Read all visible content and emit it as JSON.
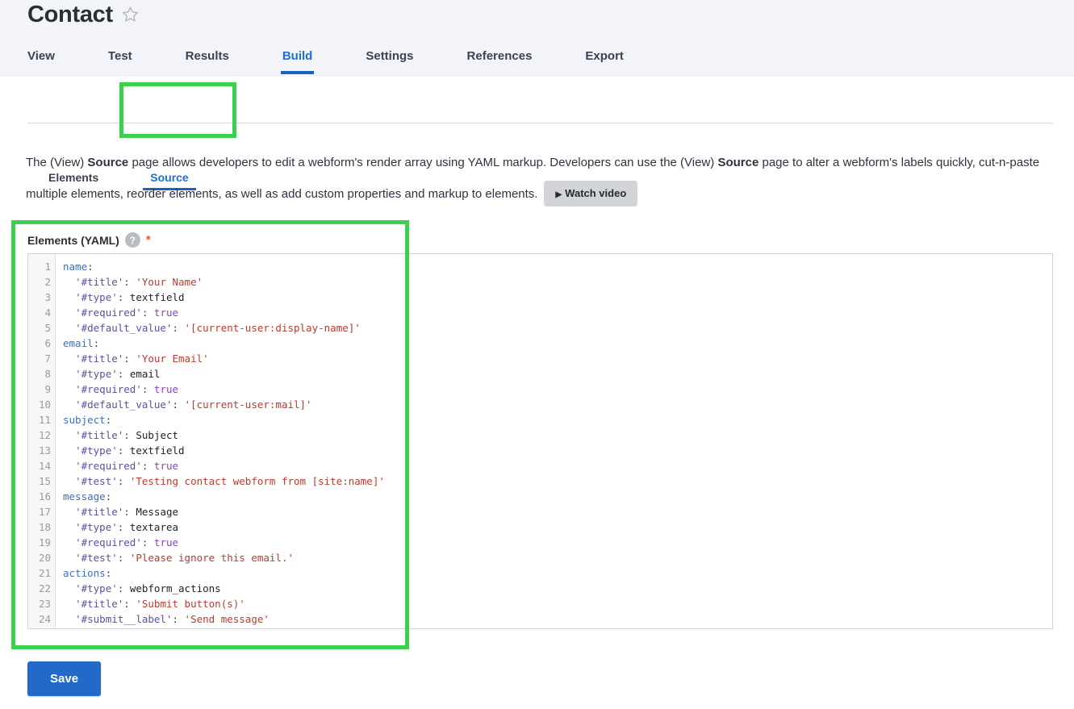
{
  "header": {
    "title": "Contact",
    "favorite_icon": "star-outline-icon"
  },
  "primary_tabs": [
    {
      "label": "View",
      "active": false
    },
    {
      "label": "Test",
      "active": false
    },
    {
      "label": "Results",
      "active": false
    },
    {
      "label": "Build",
      "active": true
    },
    {
      "label": "Settings",
      "active": false
    },
    {
      "label": "References",
      "active": false
    },
    {
      "label": "Export",
      "active": false
    }
  ],
  "secondary_tabs": [
    {
      "label": "Elements",
      "active": false
    },
    {
      "label": "Source",
      "active": true
    }
  ],
  "description": {
    "part1": "The (View) ",
    "bold1": "Source",
    "part2": " page allows developers to edit a webform's render array using YAML markup. Developers can use the (View) ",
    "bold2": "Source",
    "part3": " page to alter a webform's labels quickly, cut-n-paste multiple elements, reorder elements, as well as add custom properties and markup to elements.",
    "watch_video_label": "Watch video",
    "watch_video_icon": "play-triangle-icon"
  },
  "yaml_field": {
    "label": "Elements (YAML)",
    "help_icon": "question-mark-icon",
    "required_mark": "*"
  },
  "code": {
    "line_numbers": [
      "1",
      "2",
      "3",
      "4",
      "5",
      "6",
      "7",
      "8",
      "9",
      "10",
      "11",
      "12",
      "13",
      "14",
      "15",
      "16",
      "17",
      "18",
      "19",
      "20",
      "21",
      "22",
      "23",
      "24"
    ],
    "lines": [
      {
        "n": 1,
        "text": "name:"
      },
      {
        "n": 2,
        "text": "  '#title': 'Your Name'"
      },
      {
        "n": 3,
        "text": "  '#type': textfield"
      },
      {
        "n": 4,
        "text": "  '#required': true"
      },
      {
        "n": 5,
        "text": "  '#default_value': '[current-user:display-name]'"
      },
      {
        "n": 6,
        "text": "email:"
      },
      {
        "n": 7,
        "text": "  '#title': 'Your Email'"
      },
      {
        "n": 8,
        "text": "  '#type': email"
      },
      {
        "n": 9,
        "text": "  '#required': true"
      },
      {
        "n": 10,
        "text": "  '#default_value': '[current-user:mail]'"
      },
      {
        "n": 11,
        "text": "subject:"
      },
      {
        "n": 12,
        "text": "  '#title': Subject"
      },
      {
        "n": 13,
        "text": "  '#type': textfield"
      },
      {
        "n": 14,
        "text": "  '#required': true"
      },
      {
        "n": 15,
        "text": "  '#test': 'Testing contact webform from [site:name]'"
      },
      {
        "n": 16,
        "text": "message:"
      },
      {
        "n": 17,
        "text": "  '#title': Message"
      },
      {
        "n": 18,
        "text": "  '#type': textarea"
      },
      {
        "n": 19,
        "text": "  '#required': true"
      },
      {
        "n": 20,
        "text": "  '#test': 'Please ignore this email.'"
      },
      {
        "n": 21,
        "text": "actions:"
      },
      {
        "n": 22,
        "text": "  '#type': webform_actions"
      },
      {
        "n": 23,
        "text": "  '#title': 'Submit button(s)'"
      },
      {
        "n": 24,
        "text": "  '#submit__label': 'Send message'"
      }
    ]
  },
  "actions": {
    "save_label": "Save"
  },
  "colors": {
    "accent_blue": "#1a62c4",
    "link_blue": "#1f6fd0",
    "save_blue": "#2369c9",
    "highlight_green": "#3bd14f",
    "header_bg": "#f2f4f9",
    "required_red": "#e2593b"
  }
}
